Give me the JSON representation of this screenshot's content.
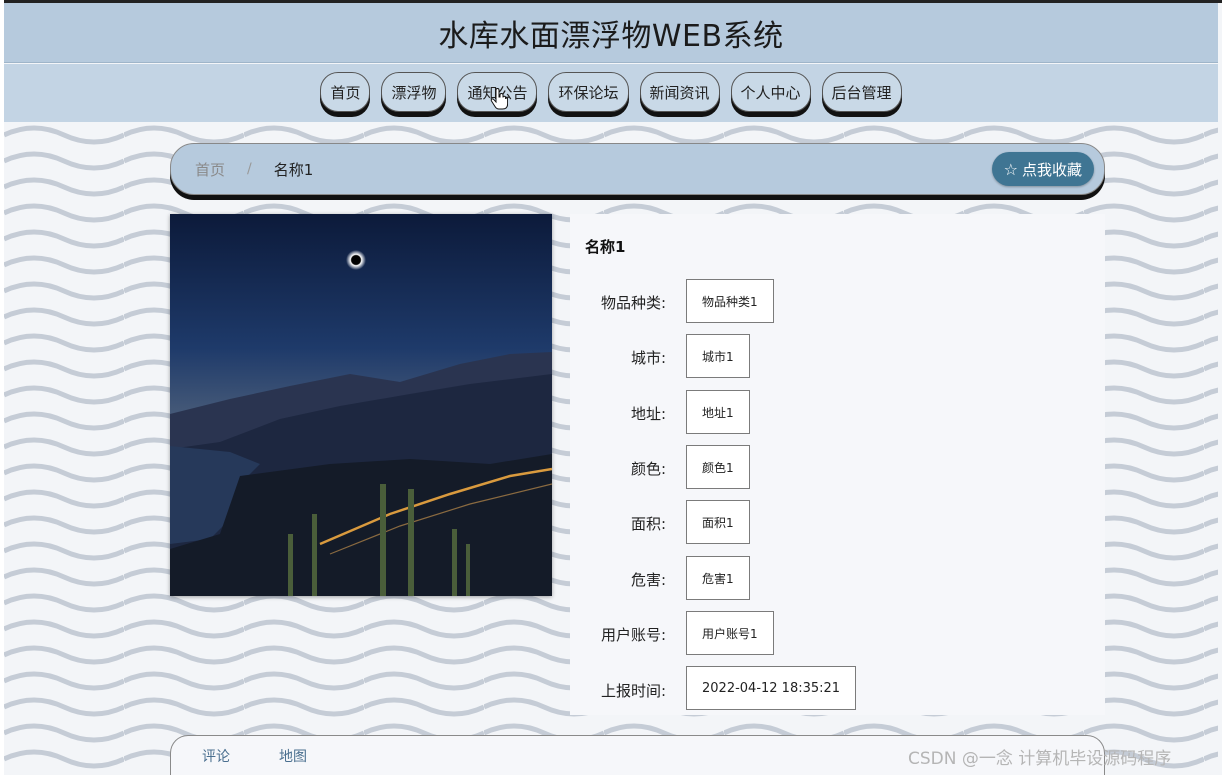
{
  "header": {
    "title": "水库水面漂浮物WEB系统"
  },
  "nav": {
    "items": [
      {
        "label": "首页",
        "icon": ""
      },
      {
        "label": "漂浮物",
        "icon": ""
      },
      {
        "label": "通知公告",
        "icon": "hand-cursor-icon"
      },
      {
        "label": "环保论坛",
        "icon": ""
      },
      {
        "label": "新闻资讯",
        "icon": ""
      },
      {
        "label": "个人中心",
        "icon": ""
      },
      {
        "label": "后台管理",
        "icon": ""
      }
    ]
  },
  "breadcrumb": {
    "home": "首页",
    "separator": "/",
    "current": "名称1"
  },
  "actions": {
    "favorite_label": "点我收藏",
    "favorite_icon": "star-outline-icon"
  },
  "detail": {
    "name": "名称1",
    "image_alt": "night mountain landscape with eclipse",
    "fields": [
      {
        "label": "物品种类:",
        "value": "物品种类1"
      },
      {
        "label": "城市:",
        "value": "城市1"
      },
      {
        "label": "地址:",
        "value": "地址1"
      },
      {
        "label": "颜色:",
        "value": "颜色1"
      },
      {
        "label": "面积:",
        "value": "面积1"
      },
      {
        "label": "危害:",
        "value": "危害1"
      },
      {
        "label": "用户账号:",
        "value": "用户账号1"
      },
      {
        "label": "上报时间:",
        "value": "2022-04-12 18:35:21"
      }
    ]
  },
  "tabs": [
    {
      "label": "评论"
    },
    {
      "label": "地图"
    }
  ],
  "watermark": "CSDN @一念 计算机毕设源码程序",
  "colors": {
    "header_bg": "#b6cadd",
    "nav_bg": "#c3d4e4",
    "accent": "#3f7593",
    "button_shadow": "#111111"
  }
}
